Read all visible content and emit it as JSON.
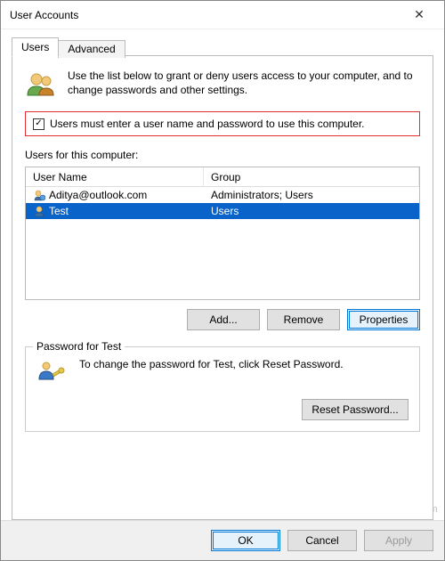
{
  "window": {
    "title": "User Accounts",
    "close_glyph": "✕"
  },
  "tabs": {
    "users": "Users",
    "advanced": "Advanced"
  },
  "intro": "Use the list below to grant or deny users access to your computer, and to change passwords and other settings.",
  "checkbox": {
    "label": "Users must enter a user name and password to use this computer.",
    "check_glyph": "✓"
  },
  "users_label": "Users for this computer:",
  "listview": {
    "columns": {
      "name": "User Name",
      "group": "Group"
    },
    "rows": [
      {
        "name": "Aditya@outlook.com",
        "group": "Administrators; Users",
        "selected": false
      },
      {
        "name": "Test",
        "group": "Users",
        "selected": true
      }
    ]
  },
  "buttons": {
    "add": "Add...",
    "remove": "Remove",
    "properties": "Properties",
    "reset": "Reset Password...",
    "ok": "OK",
    "cancel": "Cancel",
    "apply": "Apply"
  },
  "password_group": {
    "title": "Password for Test",
    "text": "To change the password for Test, click Reset Password."
  },
  "watermark": "wsxdn.com"
}
